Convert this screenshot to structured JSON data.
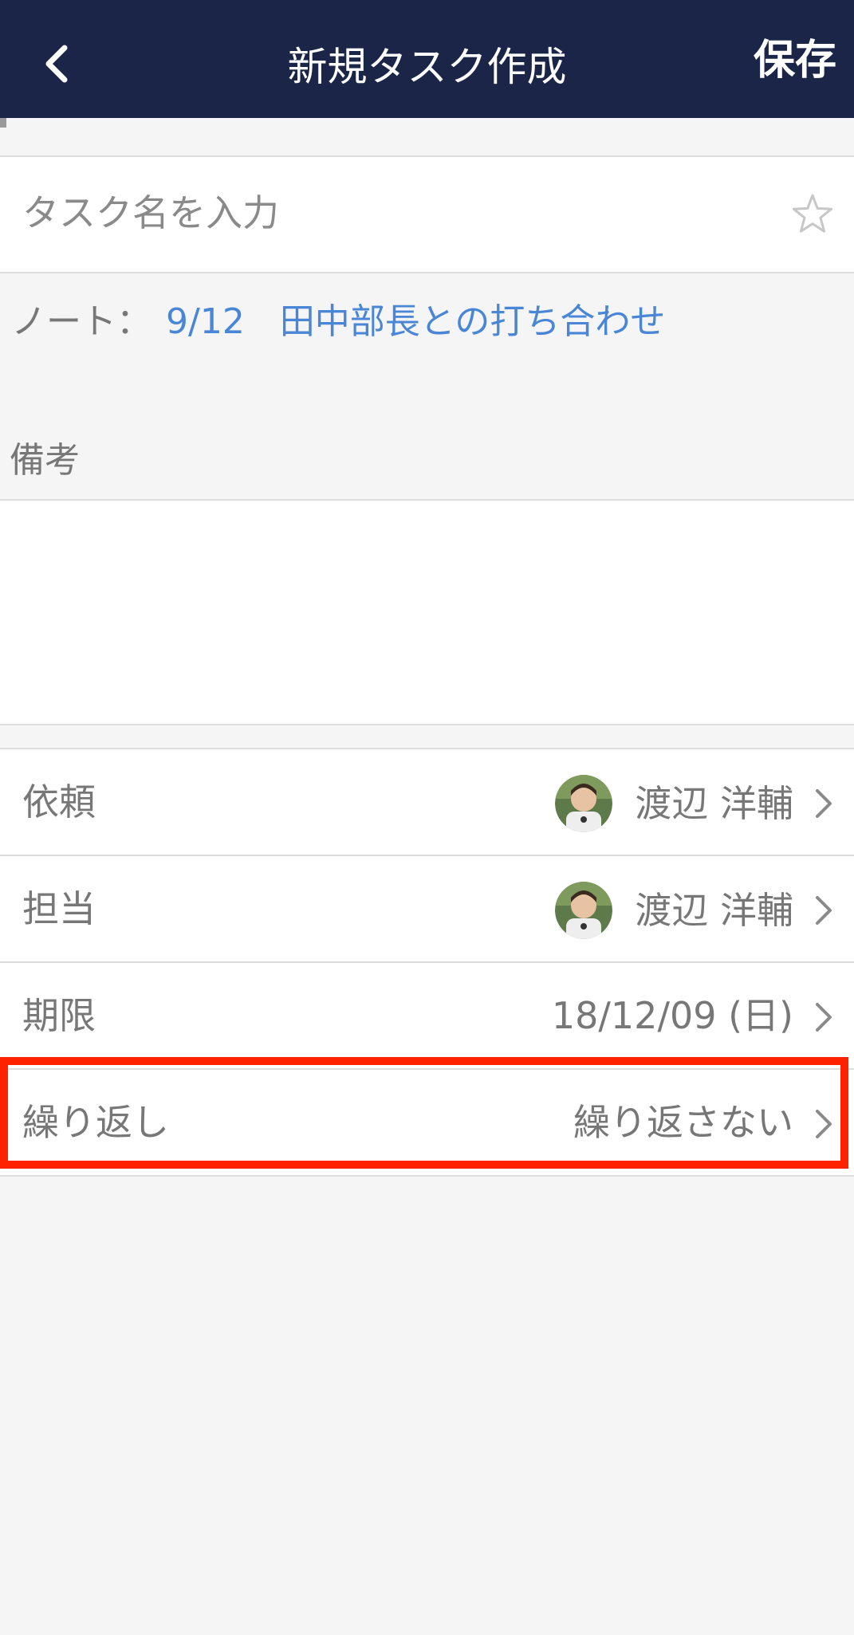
{
  "header": {
    "title": "新規タスク作成",
    "save_label": "保存",
    "back_icon": "chevron-left-icon",
    "background": "#1b2547"
  },
  "task": {
    "placeholder": "タスク名を入力",
    "value": "",
    "star_icon": "star-outline-icon"
  },
  "note": {
    "label": "ノート：",
    "link_text": "9/12　田中部長との打ち合わせ",
    "link_color": "#4a86d6"
  },
  "remarks": {
    "label": "備考",
    "value": ""
  },
  "fields": {
    "requester": {
      "label": "依頼",
      "value": "渡辺 洋輔",
      "has_avatar": true
    },
    "assignee": {
      "label": "担当",
      "value": "渡辺 洋輔",
      "has_avatar": true
    },
    "due": {
      "label": "期限",
      "value": "18/12/09 (日)"
    },
    "repeat": {
      "label": "繰り返し",
      "value": "繰り返さない",
      "highlighted": true,
      "highlight_color": "#ff2200"
    }
  }
}
